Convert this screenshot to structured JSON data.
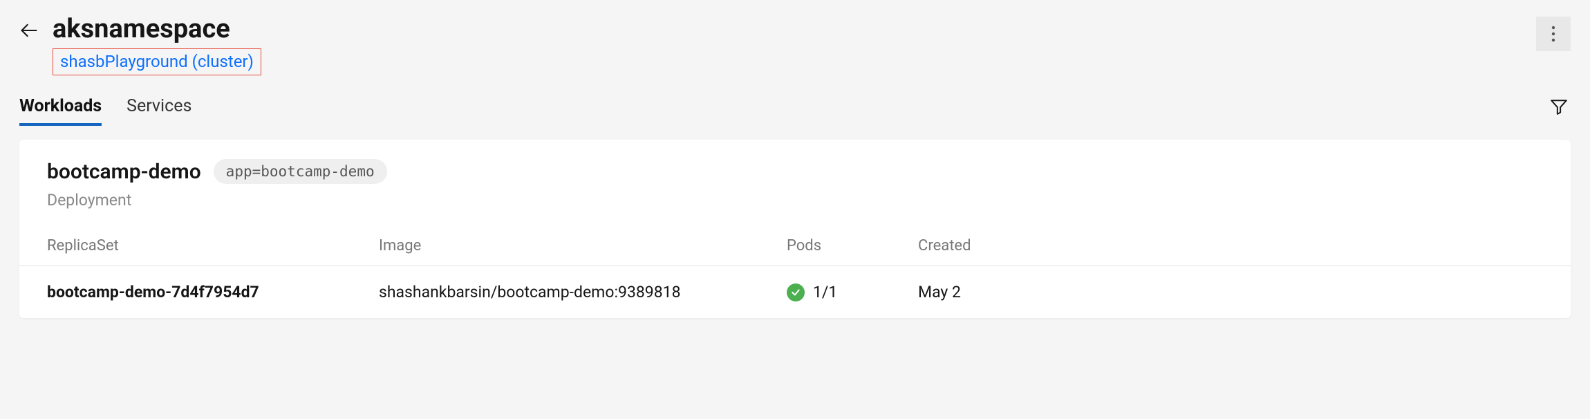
{
  "header": {
    "title": "aksnamespace",
    "cluster_link": "shasbPlayground (cluster)"
  },
  "tabs": {
    "workloads": "Workloads",
    "services": "Services"
  },
  "workload": {
    "name": "bootcamp-demo",
    "label": "app=bootcamp-demo",
    "kind": "Deployment"
  },
  "table": {
    "headers": {
      "replicaset": "ReplicaSet",
      "image": "Image",
      "pods": "Pods",
      "created": "Created"
    },
    "rows": [
      {
        "replicaset": "bootcamp-demo-7d4f7954d7",
        "image": "shashankbarsin/bootcamp-demo:9389818",
        "pods": "1/1",
        "created": "May 2"
      }
    ]
  }
}
